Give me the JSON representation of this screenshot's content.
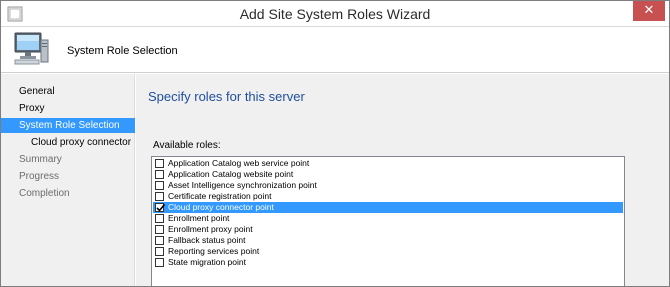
{
  "window": {
    "title": "Add Site System Roles Wizard",
    "close_glyph": "✕"
  },
  "header": {
    "title": "System Role Selection",
    "icon": "computer-icon"
  },
  "nav": {
    "items": [
      {
        "label": "General",
        "state": "normal"
      },
      {
        "label": "Proxy",
        "state": "normal"
      },
      {
        "label": "System Role Selection",
        "state": "selected"
      },
      {
        "label": "Cloud proxy connector",
        "state": "normal"
      },
      {
        "label": "Summary",
        "state": "disabled"
      },
      {
        "label": "Progress",
        "state": "disabled"
      },
      {
        "label": "Completion",
        "state": "disabled"
      }
    ]
  },
  "main": {
    "heading": "Specify roles for this server",
    "roles_label": "Available roles:",
    "roles": [
      {
        "label": "Application Catalog web service point",
        "checked": false,
        "selected": false
      },
      {
        "label": "Application Catalog website point",
        "checked": false,
        "selected": false
      },
      {
        "label": "Asset Intelligence synchronization point",
        "checked": false,
        "selected": false
      },
      {
        "label": "Certificate registration point",
        "checked": false,
        "selected": false
      },
      {
        "label": "Cloud proxy connector point",
        "checked": true,
        "selected": true
      },
      {
        "label": "Enrollment point",
        "checked": false,
        "selected": false
      },
      {
        "label": "Enrollment proxy point",
        "checked": false,
        "selected": false
      },
      {
        "label": "Fallback status point",
        "checked": false,
        "selected": false
      },
      {
        "label": "Reporting services point",
        "checked": false,
        "selected": false
      },
      {
        "label": "State migration point",
        "checked": false,
        "selected": false
      }
    ]
  },
  "colors": {
    "selection": "#3399ff",
    "heading": "#1f4e9c",
    "close_button": "#c75050",
    "panel": "#f0f0f0"
  }
}
